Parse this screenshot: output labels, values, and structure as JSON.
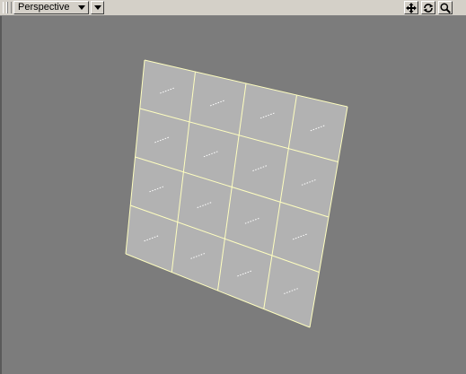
{
  "toolbar": {
    "view_mode": "Perspective",
    "view_menu_icon": "chevron-down-icon",
    "tools": [
      {
        "name": "move-view-icon"
      },
      {
        "name": "rotate-view-icon"
      },
      {
        "name": "zoom-view-icon"
      }
    ]
  },
  "viewport": {
    "object": "subdivided-plane",
    "grid_columns": 4,
    "grid_rows": 4,
    "colors": {
      "background": "#7c7c7c",
      "face": "#b2b2b2",
      "edge": "#ffffc0",
      "normal_marker": "#ffffff"
    }
  }
}
